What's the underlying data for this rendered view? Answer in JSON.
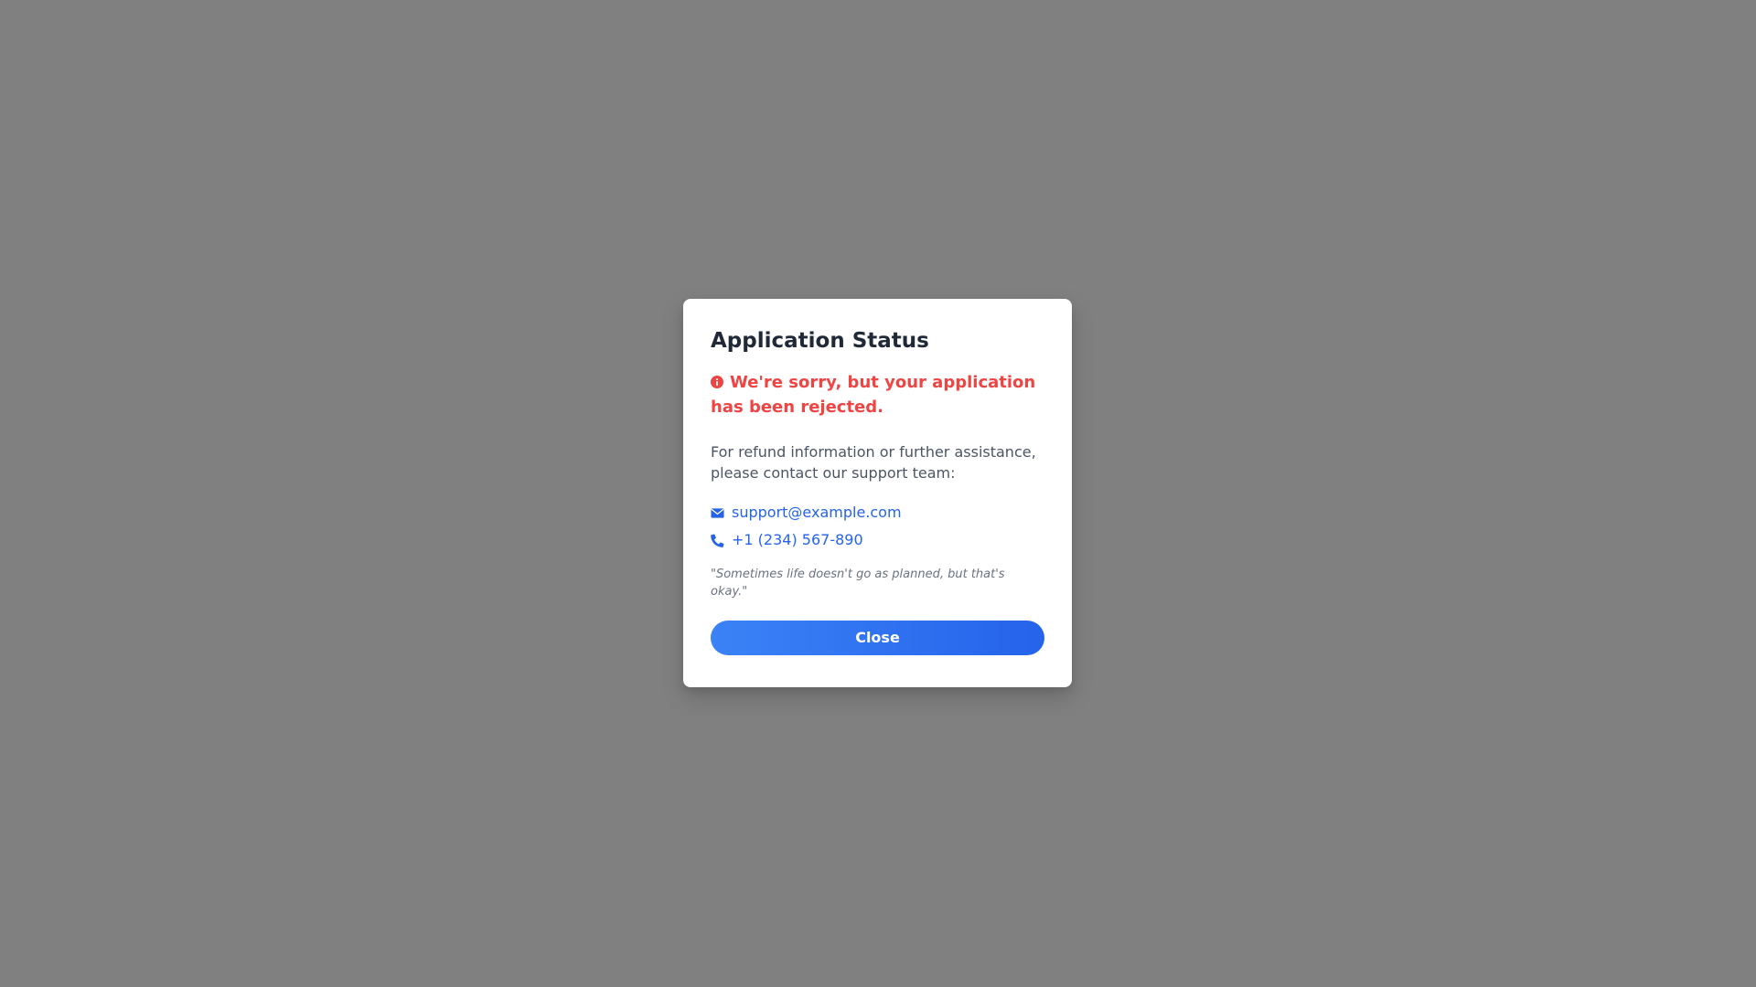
{
  "modal": {
    "title": "Application Status",
    "error_message": "We're sorry, but your application has been rejected.",
    "error_icon": "info-circle-icon",
    "assist_text": "For refund information or further assistance, please contact our support team:",
    "contacts": [
      {
        "icon": "envelope-icon",
        "label": "support@example.com"
      },
      {
        "icon": "phone-icon",
        "label": "+1 (234) 567-890"
      }
    ],
    "quote": "\"Sometimes life doesn't go as planned, but that's okay.\"",
    "close_label": "Close"
  },
  "colors": {
    "backdrop": "#808080",
    "error": "#ef4444",
    "link": "#2563eb",
    "button_start": "#3b82f6",
    "button_end": "#2563eb"
  }
}
